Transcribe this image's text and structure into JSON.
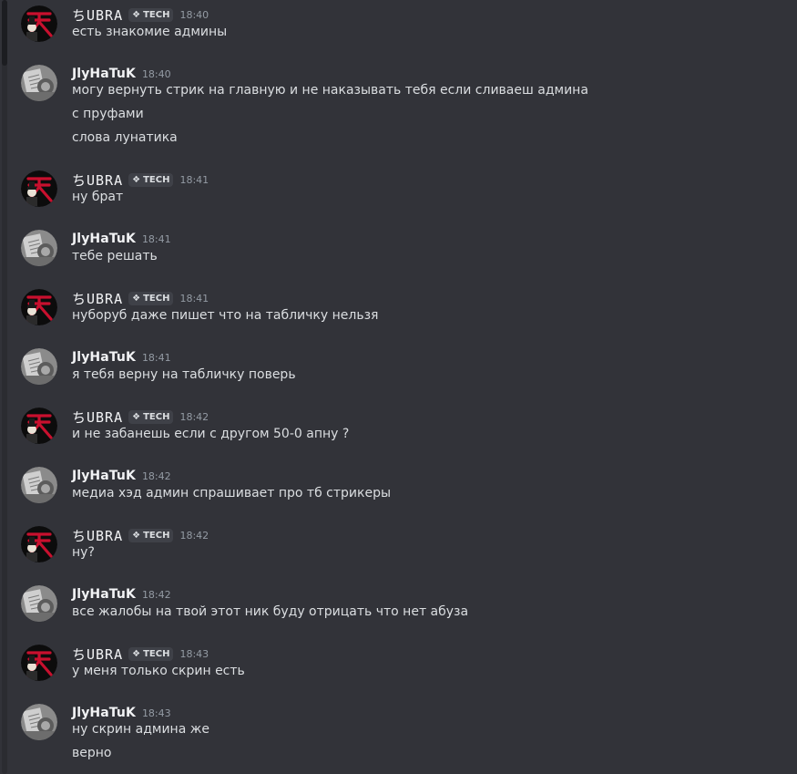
{
  "users": {
    "subra": {
      "name": "ちUBRA",
      "tag": "TECH",
      "tag_icon": "diamond-icon"
    },
    "lunatik": {
      "name": "JlyHaTuK"
    }
  },
  "messages": [
    {
      "user": "ちUBRA",
      "tag": "TECH",
      "time": "18:40",
      "lines": [
        "есть знакомие админы"
      ]
    },
    {
      "user": "JlyHaTuK",
      "time": "18:40",
      "lines": [
        "могу вернуть стрик на главную и не наказывать тебя если сливаеш админа",
        "с пруфами",
        "слова лунатика"
      ]
    },
    {
      "user": "ちUBRA",
      "tag": "TECH",
      "time": "18:41",
      "lines": [
        "ну брат"
      ]
    },
    {
      "user": "JlyHaTuK",
      "time": "18:41",
      "lines": [
        "тебе решать"
      ]
    },
    {
      "user": "ちUBRA",
      "tag": "TECH",
      "time": "18:41",
      "lines": [
        "нуборуб даже пишет что на табличку нельзя"
      ]
    },
    {
      "user": "JlyHaTuK",
      "time": "18:41",
      "lines": [
        "я тебя верну на табличку поверь"
      ]
    },
    {
      "user": "ちUBRA",
      "tag": "TECH",
      "time": "18:42",
      "lines": [
        "и не забанешь если с другом 50-0 апну ?"
      ]
    },
    {
      "user": "JlyHaTuK",
      "time": "18:42",
      "lines": [
        "медиа хэд админ спрашивает про тб стрикеры"
      ]
    },
    {
      "user": "ちUBRA",
      "tag": "TECH",
      "time": "18:42",
      "lines": [
        "ну?"
      ]
    },
    {
      "user": "JlyHaTuK",
      "time": "18:42",
      "lines": [
        "все жалобы на твой этот ник буду отрицать что нет абуза"
      ]
    },
    {
      "user": "ちUBRA",
      "tag": "TECH",
      "time": "18:43",
      "lines": [
        "у меня только скрин есть"
      ]
    },
    {
      "user": "JlyHaTuK",
      "time": "18:43",
      "lines": [
        "ну скрин админа же",
        "верно"
      ]
    }
  ],
  "colors": {
    "background": "#323339",
    "username": "#f2f3f5",
    "text": "#dbdee1",
    "timestamp": "#949ba4",
    "tag_bg": "#3f4148",
    "avatar_accent": "#c8102e"
  }
}
